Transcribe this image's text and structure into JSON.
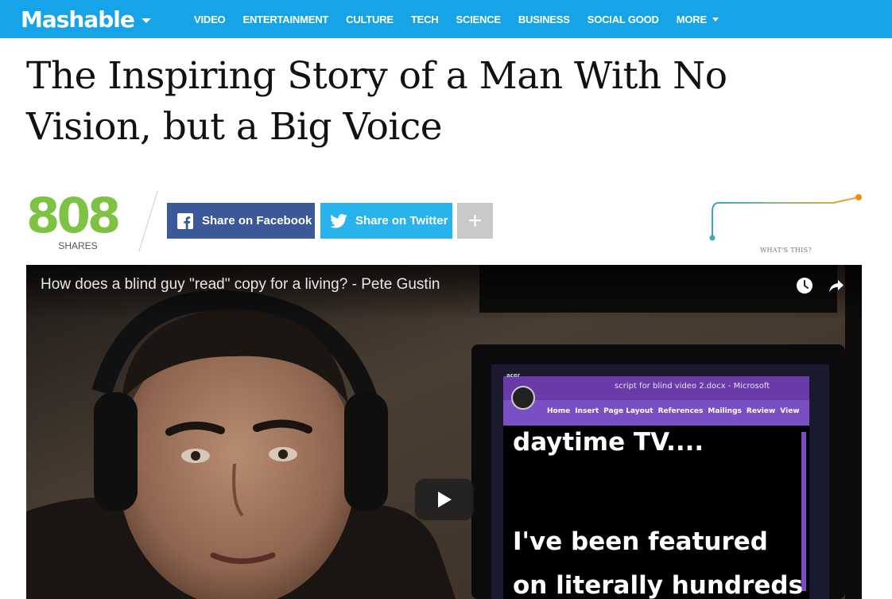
{
  "nav": {
    "logo": "Mashable",
    "items": [
      "VIDEO",
      "ENTERTAINMENT",
      "CULTURE",
      "TECH",
      "SCIENCE",
      "BUSINESS",
      "SOCIAL GOOD",
      "MORE"
    ],
    "background": "#16a3e8"
  },
  "article": {
    "headline": "The Inspiring Story of a Man With No Vision, but a Big Voice"
  },
  "shares": {
    "count": "808",
    "label": "SHARES",
    "facebook_label": "Share on Facebook",
    "twitter_label": "Share on Twitter",
    "more_label": "+",
    "whats_this": "WHAT'S THIS?",
    "count_color": "#7dc243",
    "facebook_color": "#3b5998",
    "twitter_color": "#29b3ec"
  },
  "video": {
    "title": "How does a blind guy \"read\" copy for a living? - Pete Gustin",
    "icons": [
      "watch-later-icon",
      "share-arrow-icon",
      "play-icon"
    ],
    "monitor": {
      "brand": "acer",
      "window_title": "script for blind video 2.docx - Microsoft",
      "ribbon_tabs": [
        "Home",
        "Insert",
        "Page Layout",
        "References",
        "Mailings",
        "Review",
        "View"
      ],
      "line1": "daytime TV....",
      "line2": "I've been featured",
      "line3": "on literally hundreds"
    }
  }
}
